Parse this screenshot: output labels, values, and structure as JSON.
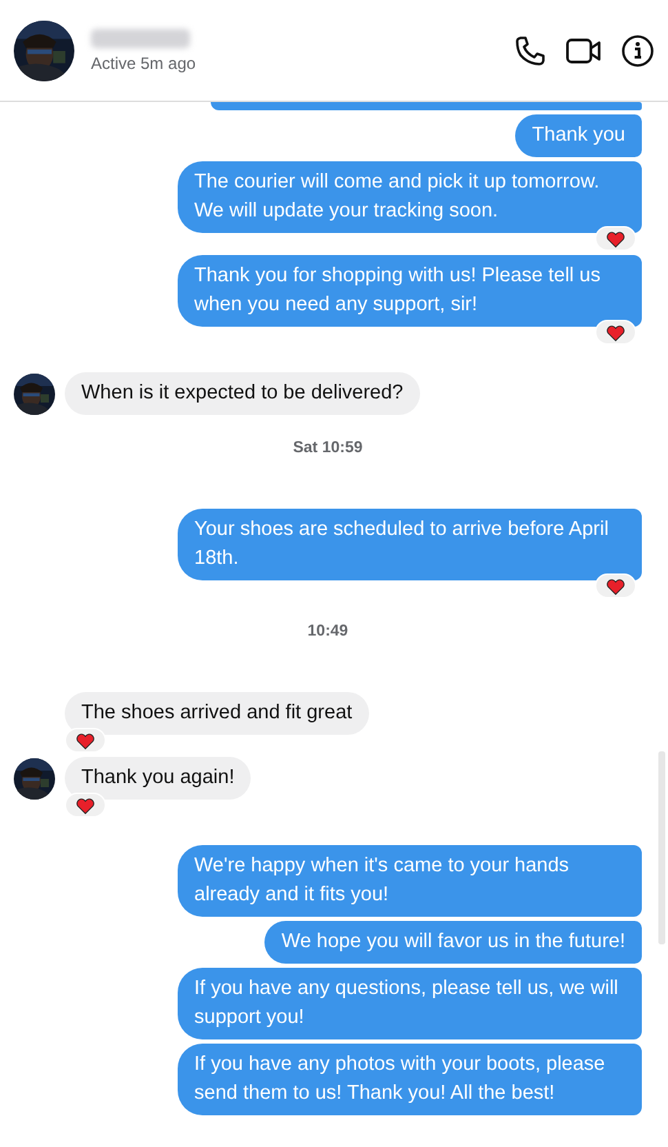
{
  "header": {
    "status": "Active 5m ago"
  },
  "messages": [
    {
      "kind": "outgoing",
      "cut": true
    },
    {
      "kind": "outgoing",
      "text": "Thank you",
      "reacted": false
    },
    {
      "kind": "outgoing",
      "text": "The courier will come and pick it up tomorrow. We will update your tracking soon.",
      "reacted": true
    },
    {
      "kind": "outgoing",
      "text": "Thank you for shopping with us! Please tell us when you need any support, sir!",
      "reacted": true
    },
    {
      "kind": "incoming",
      "text": "When is it expected to be delivered?",
      "reacted": false,
      "avatar": true
    },
    {
      "kind": "time",
      "text": "Sat 10:59"
    },
    {
      "kind": "outgoing",
      "text": "Your shoes are scheduled to arrive before April 18th.",
      "reacted": true
    },
    {
      "kind": "time",
      "text": "10:49"
    },
    {
      "kind": "incoming",
      "text": "The shoes arrived and fit great",
      "reacted": true,
      "avatar": false
    },
    {
      "kind": "incoming",
      "text": "Thank you again!",
      "reacted": true,
      "avatar": true
    },
    {
      "kind": "outgoing",
      "text": "We're happy when it's came to your hands already and it fits you!",
      "reacted": false
    },
    {
      "kind": "outgoing",
      "text": "We hope you will favor us in the future!",
      "reacted": false
    },
    {
      "kind": "outgoing",
      "text": "If you have any questions, please tell us, we will support you!",
      "reacted": false
    },
    {
      "kind": "outgoing",
      "text": "If you have any photos with your boots, please send them to us! Thank you! All the best!",
      "reacted": false
    }
  ]
}
